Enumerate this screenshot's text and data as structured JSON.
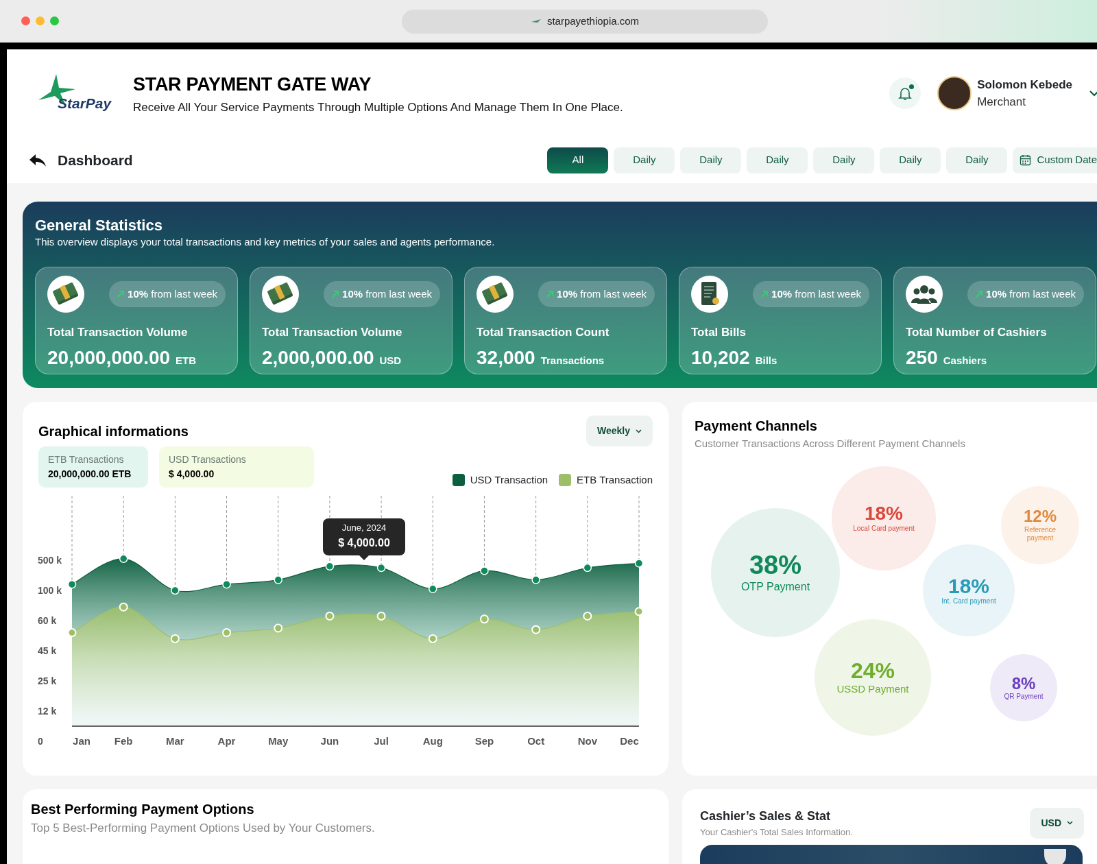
{
  "browser": {
    "url": "starpayethiopia.com"
  },
  "header": {
    "logo_text": "StarPay",
    "title": "STAR PAYMENT GATE WAY",
    "subtitle": "Receive All Your Service Payments Through Multiple Options And Manage Them In One Place.",
    "notification_unread": true,
    "user": {
      "name": "Solomon Kebede",
      "role": "Merchant"
    }
  },
  "toolbar": {
    "title": "Dashboard",
    "tabs": [
      {
        "label": "All",
        "selected": true
      },
      {
        "label": "Daily",
        "selected": false
      },
      {
        "label": "Daily",
        "selected": false
      },
      {
        "label": "Daily",
        "selected": false
      },
      {
        "label": "Daily",
        "selected": false
      },
      {
        "label": "Daily",
        "selected": false
      },
      {
        "label": "Daily",
        "selected": false
      }
    ],
    "custom_date": "Custom Date"
  },
  "general_statistics": {
    "title": "General Statistics",
    "subtitle": "This overview displays your total transactions and key metrics of your sales and agents performance.",
    "cards": [
      {
        "kind": "money",
        "trend": "**10%** from last week",
        "label": "Total Transaction Volume",
        "value": "20,000,000.00",
        "unit": "ETB"
      },
      {
        "kind": "money",
        "trend": "**10%** from last week",
        "label": "Total Transaction Volume",
        "value": "2,000,000.00",
        "unit": "USD"
      },
      {
        "kind": "money",
        "trend": "**10%** from last week",
        "label": "Total Transaction Count",
        "value": "32,000",
        "unit": "Transactions"
      },
      {
        "kind": "bill",
        "trend": "**10%** from last week",
        "label": "Total Bills",
        "value": "10,202",
        "unit": "Bills"
      },
      {
        "kind": "people",
        "trend": "**10%** from last week",
        "label": "Total Number of Cashiers",
        "value": "250",
        "unit": "Cashiers"
      }
    ]
  },
  "graph": {
    "title": "Graphical informations",
    "period": "Weekly",
    "summaries": [
      {
        "label": "ETB Transactions",
        "value": "20,000,000.00 ETB",
        "color": "#e2f5ee"
      },
      {
        "label": "USD Transactions",
        "value": "$ 4,000.00",
        "color": "#f3fbe2"
      }
    ],
    "tooltip": {
      "title": "June, 2024",
      "value": "$ 4,000.00"
    },
    "x_axis_labels": [
      "Jan",
      "Feb",
      "Mar",
      "Apr",
      "May",
      "Jun",
      "Jul",
      "Aug",
      "Sep",
      "Oct",
      "Nov",
      "Dec"
    ],
    "y_axis_labels": [
      "500 k",
      "100 k",
      "60 k",
      "45 k",
      "25 k",
      "12 k",
      "0"
    ],
    "legend": [
      {
        "name": "USD Transaction",
        "color": "#0b5e3e"
      },
      {
        "name": "ETB Transaction",
        "color": "#9dbf6a"
      }
    ]
  },
  "payment_channels": {
    "title": "Payment Channels",
    "subtitle": "Customer Transactions Across Different Payment Channels",
    "channels": [
      {
        "percent": "38%",
        "label": "OTP Payment",
        "color": "#10895a"
      },
      {
        "percent": "18%",
        "label": "Local Card payment",
        "color": "#d9483b"
      },
      {
        "percent": "12%",
        "label": "Reference payment",
        "color": "#e0893d"
      },
      {
        "percent": "18%",
        "label": "Int. Card payment",
        "color": "#2a9bb7"
      },
      {
        "percent": "24%",
        "label": "USSD Payment",
        "color": "#6eae2c"
      },
      {
        "percent": "8%",
        "label": "QR Payment",
        "color": "#6b3fc0"
      }
    ]
  },
  "best_performing": {
    "title": "Best Performing Payment Options",
    "subtitle": "Top 5 Best-Performing Payment Options Used by Your Customers."
  },
  "cashier_sales": {
    "title": "Cashier’s Sales & Stat",
    "subtitle": "Your Cashier's Total Sales Information.",
    "currency": "USD"
  }
}
